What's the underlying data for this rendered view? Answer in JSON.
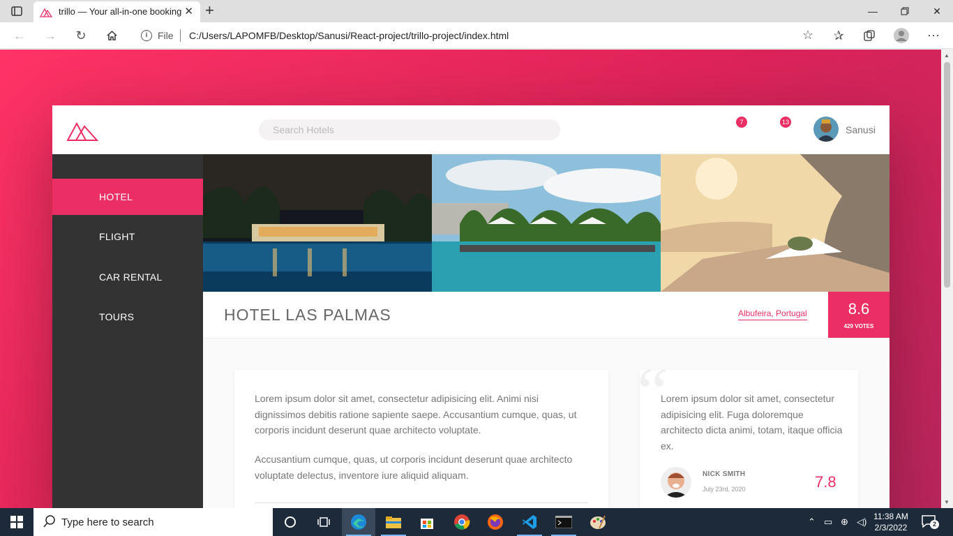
{
  "browser": {
    "tab_title": "trillo — Your all-in-one booking app",
    "address_label": "File",
    "url": "C:/Users/LAPOMFB/Desktop/Sanusi/React-project/trillo-project/index.html"
  },
  "header": {
    "search_placeholder": "Search Hotels",
    "bookmark_count": "7",
    "message_count": "13",
    "user_name": "Sanusi"
  },
  "sidebar": {
    "items": [
      {
        "label": "HOTEL",
        "active": true
      },
      {
        "label": "FLIGHT",
        "active": false
      },
      {
        "label": "CAR RENTAL",
        "active": false
      },
      {
        "label": "TOURS",
        "active": false
      }
    ]
  },
  "overview": {
    "heading": "HOTEL LAS PALMAS",
    "location": "Albufeira, Portugal",
    "rating_average": "8.6",
    "rating_count": "429 VOTES"
  },
  "description": {
    "paragraph_1": "Lorem ipsum dolor sit amet, consectetur adipisicing elit. Animi nisi dignissimos debitis ratione sapiente saepe. Accusantium cumque, quas, ut corporis incidunt deserunt quae architecto voluptate.",
    "paragraph_2": "Accusantium cumque, quas, ut corporis incidunt deserunt quae architecto voluptate delectus, inventore iure aliquid aliquam."
  },
  "review": {
    "quote_mark": "“",
    "text": "Lorem ipsum dolor sit amet, consectetur adipisicing elit. Fuga doloremque architecto dicta animi, totam, itaque officia ex.",
    "user_name": "NICK SMITH",
    "date": "July 23rd, 2020",
    "rating": "7.8"
  },
  "taskbar": {
    "search_text": "Type here to search",
    "time": "11:38 AM",
    "date": "2/3/2022",
    "notification_count": "2"
  },
  "colors": {
    "primary": "#eb2f64",
    "sidebar": "#333333",
    "taskbar": "#1c2a3a"
  },
  "icons": [
    "tab-actions-icon",
    "trillo-logo-icon",
    "close-icon",
    "plus-icon",
    "minimize-icon",
    "restore-icon",
    "back-icon",
    "forward-icon",
    "refresh-icon",
    "home-icon",
    "info-icon",
    "add-favorite-icon",
    "favorites-icon",
    "collections-icon",
    "profile-icon",
    "more-icon",
    "windows-start-icon",
    "search-icon",
    "cortana-icon",
    "task-view-icon",
    "edge-icon",
    "file-explorer-icon",
    "store-icon",
    "chrome-icon",
    "firefox-icon",
    "vscode-icon",
    "terminal-icon",
    "paint-icon",
    "chevron-up-icon",
    "network-icon",
    "language-icon",
    "volume-icon",
    "notification-icon"
  ]
}
